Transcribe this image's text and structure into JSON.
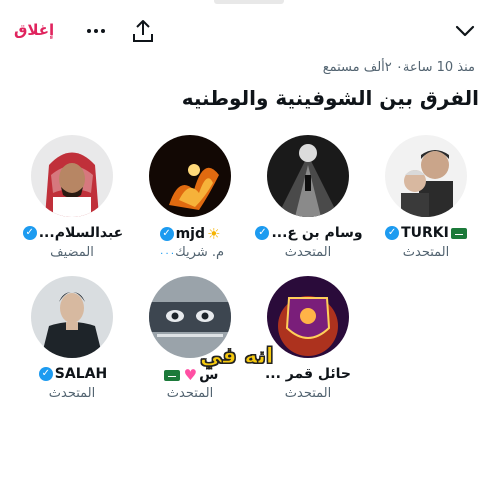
{
  "header": {
    "close_label": "إغلاق",
    "more_icon": "more-icon",
    "share_icon": "share-icon",
    "collapse_icon": "chevron-down-icon"
  },
  "space": {
    "meta": "منذ 10 ساعة٠ ٢ألف مستمع",
    "title": "الفرق بين الشوفينية والوطنيه"
  },
  "speakers": [
    {
      "name": "TURKI",
      "role": "المتحدث",
      "verified": true,
      "flag": true
    },
    {
      "name": "وسام بن ع...",
      "role": "المتحدث",
      "verified": true
    },
    {
      "name": "mjd",
      "role": "م. شريك",
      "role_prefix": "٠٠٠",
      "verified": true,
      "emoji": "sun"
    },
    {
      "name": "عبدالسلام...",
      "role": "المضيف",
      "verified": true
    },
    {
      "name": "حائل قمر ...",
      "role": "المتحدث"
    },
    {
      "name": "س",
      "role": "المتحدث",
      "emoji": "heart",
      "flag": true
    },
    {
      "name": "SALAH",
      "role": "المتحدث",
      "verified": true
    }
  ],
  "overlay": {
    "text": "انه في"
  },
  "colors": {
    "accent": "#1d9bf0",
    "close_red": "#e0245e",
    "muted": "#536471"
  }
}
